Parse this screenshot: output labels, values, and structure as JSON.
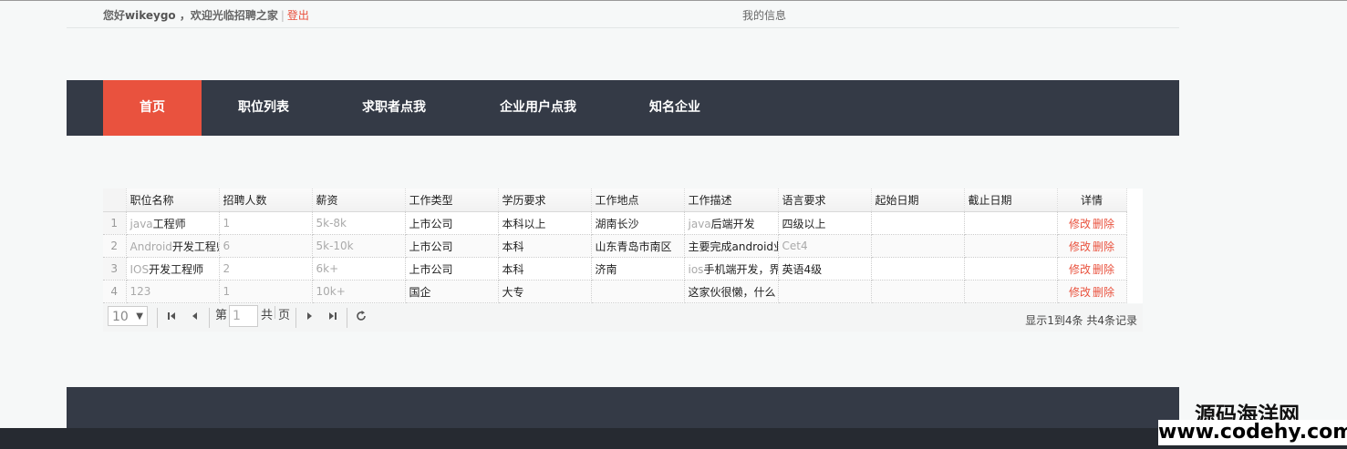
{
  "header": {
    "greeting_prefix": "您好",
    "username": "wikeygo",
    "greeting_suffix": " ，欢迎光临招聘之家",
    "separator": "|",
    "logout": "登出",
    "my_info": "我的信息"
  },
  "nav": {
    "items": [
      "首页",
      "职位列表",
      "求职者点我",
      "企业用户点我",
      "知名企业"
    ],
    "active_index": 0
  },
  "table": {
    "columns": [
      "职位名称",
      "招聘人数",
      "薪资",
      "工作类型",
      "学历要求",
      "工作地点",
      "工作描述",
      "语言要求",
      "起始日期",
      "截止日期",
      "详情"
    ],
    "rows": [
      {
        "num": "1",
        "name_a": "java",
        "name_b": "工程师",
        "count": "1",
        "salary": "5k-8k",
        "type": "上市公司",
        "edu": "本科以上",
        "loc": "湖南长沙",
        "desc_a": "java",
        "desc_b": "后端开发",
        "lang_a": "四级以上",
        "lang_b": "",
        "start": "",
        "end": ""
      },
      {
        "num": "2",
        "name_a": "Android",
        "name_b": "开发工程师",
        "count": "6",
        "salary": "5k-10k",
        "type": "上市公司",
        "edu": "本科",
        "loc": "山东青岛市南区",
        "desc_a": "",
        "desc_b": "主要完成android业",
        "lang_a": "",
        "lang_b": "Cet4",
        "start": "",
        "end": ""
      },
      {
        "num": "3",
        "name_a": "IOS",
        "name_b": "开发工程师",
        "count": "2",
        "salary": "6k+",
        "type": "上市公司",
        "edu": "本科",
        "loc": "济南",
        "desc_a": "ios",
        "desc_b": "手机端开发，界",
        "lang_a": "英语",
        "lang_b": "4级",
        "start": "",
        "end": ""
      },
      {
        "num": "4",
        "name_a": "123",
        "name_b": "",
        "count": "1",
        "salary": "10k+",
        "type": "国企",
        "edu": "大专",
        "loc": "",
        "desc_a": "",
        "desc_b": "这家伙很懒，什么",
        "lang_a": "",
        "lang_b": "",
        "start": "",
        "end": ""
      }
    ],
    "edit_label": "修改",
    "delete_label": "删除"
  },
  "pager": {
    "page_size": "10",
    "page_prefix": "第",
    "current_page": "1",
    "total_prefix": "共",
    "page_suffix": "页",
    "info": "显示1到4条 共4条记录"
  },
  "watermark": {
    "cn": "源码海洋网",
    "url": "www.codehy.com"
  },
  "colors": {
    "accent": "#e9523e",
    "nav_bg": "#343a46",
    "page_bg": "#f6f8f8"
  }
}
